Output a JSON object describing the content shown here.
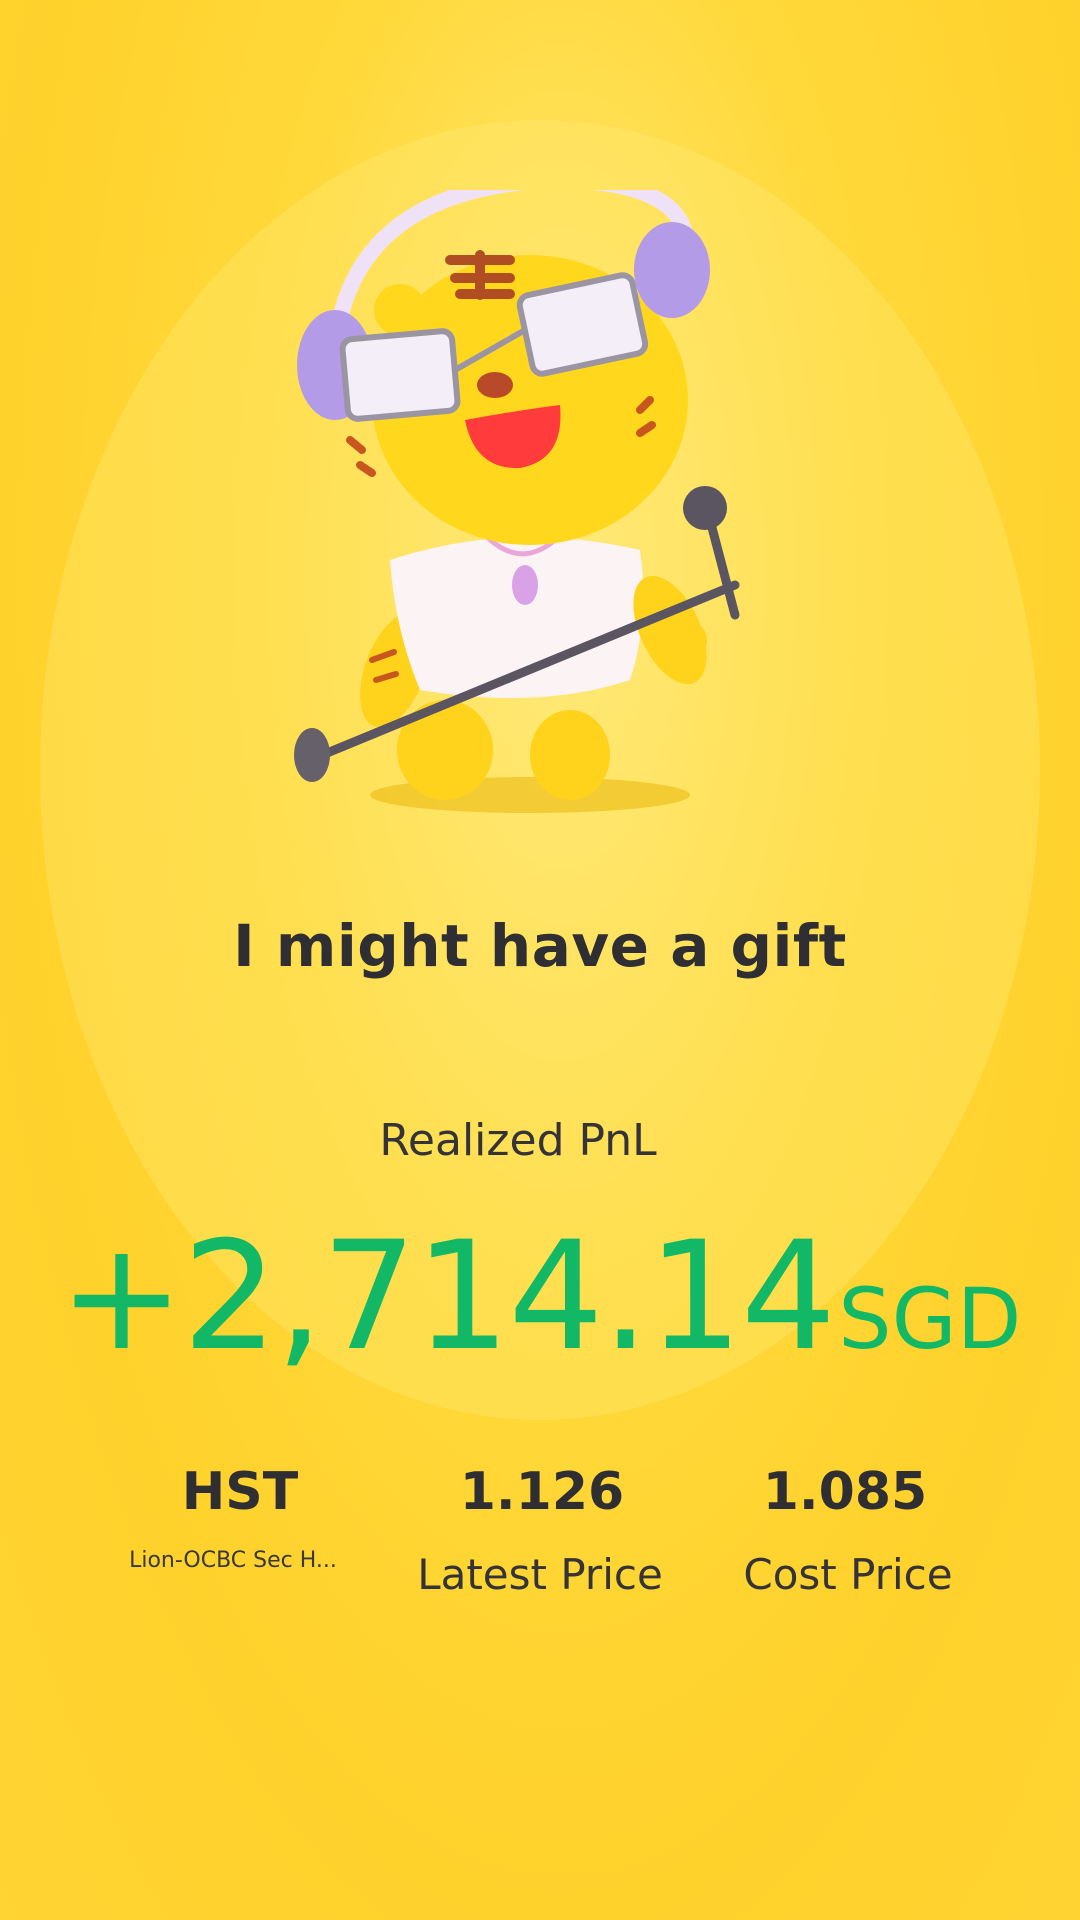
{
  "headline": "I might have a gift",
  "pnl": {
    "label": "Realized PnL",
    "amount": "+2,714.14",
    "currency": "SGD",
    "color": "#12b866"
  },
  "stock": {
    "symbol": "HST",
    "name": "Lion-OCBC Sec H...",
    "latest_price": "1.126",
    "latest_price_label": "Latest Price",
    "cost_price": "1.085",
    "cost_price_label": "Cost Price"
  },
  "mascot": {
    "icon": "tiger-mascot-singing-icon"
  },
  "colors": {
    "background": "#ffd433",
    "text": "#2e2e33"
  }
}
